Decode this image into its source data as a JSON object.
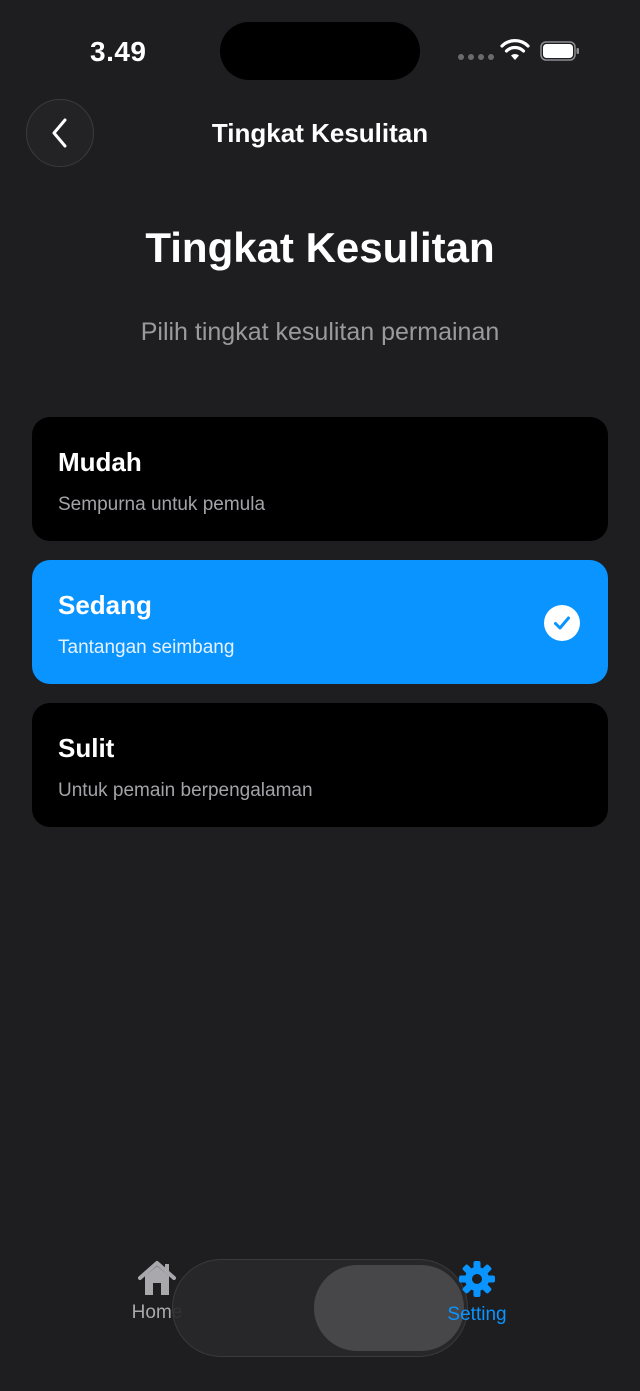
{
  "status_bar": {
    "time": "3.49"
  },
  "nav": {
    "title": "Tingkat Kesulitan"
  },
  "header": {
    "title": "Tingkat Kesulitan",
    "subtitle": "Pilih tingkat kesulitan permainan"
  },
  "options": [
    {
      "name": "Mudah",
      "description": "Sempurna untuk pemula",
      "selected": false
    },
    {
      "name": "Sedang",
      "description": "Tantangan seimbang",
      "selected": true
    },
    {
      "name": "Sulit",
      "description": "Untuk pemain berpengalaman",
      "selected": false
    }
  ],
  "tab_bar": {
    "tabs": [
      {
        "label": "Home",
        "icon": "house-icon",
        "active": false
      },
      {
        "label": "Setting",
        "icon": "gear-icon",
        "active": true
      }
    ]
  },
  "colors": {
    "background": "#1e1e20",
    "accent": "#0a94ff",
    "card": "#000000"
  }
}
